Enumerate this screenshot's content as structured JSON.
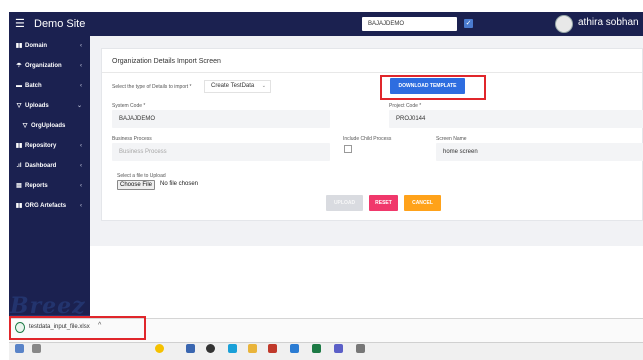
{
  "header": {
    "menu_icon": "hamburger-icon",
    "site_title": "Demo Site",
    "org_select_value": "BAJAJDEMO",
    "checkbox_checked": true,
    "user_name": "athira sobhan"
  },
  "sidebar": {
    "items": [
      {
        "label": "Domain",
        "icon": "bar-chart-icon",
        "chevron": "‹"
      },
      {
        "label": "Organization",
        "icon": "umbrella-icon",
        "chevron": "‹"
      },
      {
        "label": "Batch",
        "icon": "folder-icon",
        "chevron": "‹"
      },
      {
        "label": "Uploads",
        "icon": "filter-icon",
        "chevron": "⌄"
      },
      {
        "label": "OrgUploads",
        "icon": "filter-icon",
        "chevron": ""
      },
      {
        "label": "Repository",
        "icon": "bar-chart-icon",
        "chevron": "‹"
      },
      {
        "label": "Dashboard",
        "icon": "signal-icon",
        "chevron": "‹"
      },
      {
        "label": "Reports",
        "icon": "document-icon",
        "chevron": "‹"
      },
      {
        "label": "ORG Artefacts",
        "icon": "bar-chart-icon",
        "chevron": "‹"
      }
    ]
  },
  "form": {
    "title": "Organization Details Import Screen",
    "type_label": "Select the type of Details to import *",
    "type_value": "Create TestData",
    "download_button": "DOWNLOAD TEMPLATE",
    "system_code_label": "System Code *",
    "system_code_value": "BAJAJDEMO",
    "project_code_label": "Project Code *",
    "project_code_value": "PROJ0144",
    "business_process_label": "Business Process",
    "business_process_placeholder": "Business Process",
    "include_child_label": "Include Child Process",
    "screen_name_label": "Screen Name",
    "screen_name_value": "home screen",
    "file_label": "Select a file to Upload",
    "choose_file_button": "Choose File",
    "no_file_text": "No file chosen",
    "upload_button": "UPLOAD",
    "reset_button": "RESET",
    "cancel_button": "CANCEL"
  },
  "brand": {
    "logo_text": "Breez"
  },
  "downloads": {
    "file_name": "testdata_input_file.xlsx",
    "file_icon": "excel-file-icon",
    "chevron": "^"
  },
  "colors": {
    "nav_bg": "#1b2150",
    "primary": "#2e6de0",
    "reset": "#f0386b",
    "cancel": "#ffa21a",
    "highlight": "#e0262b"
  }
}
